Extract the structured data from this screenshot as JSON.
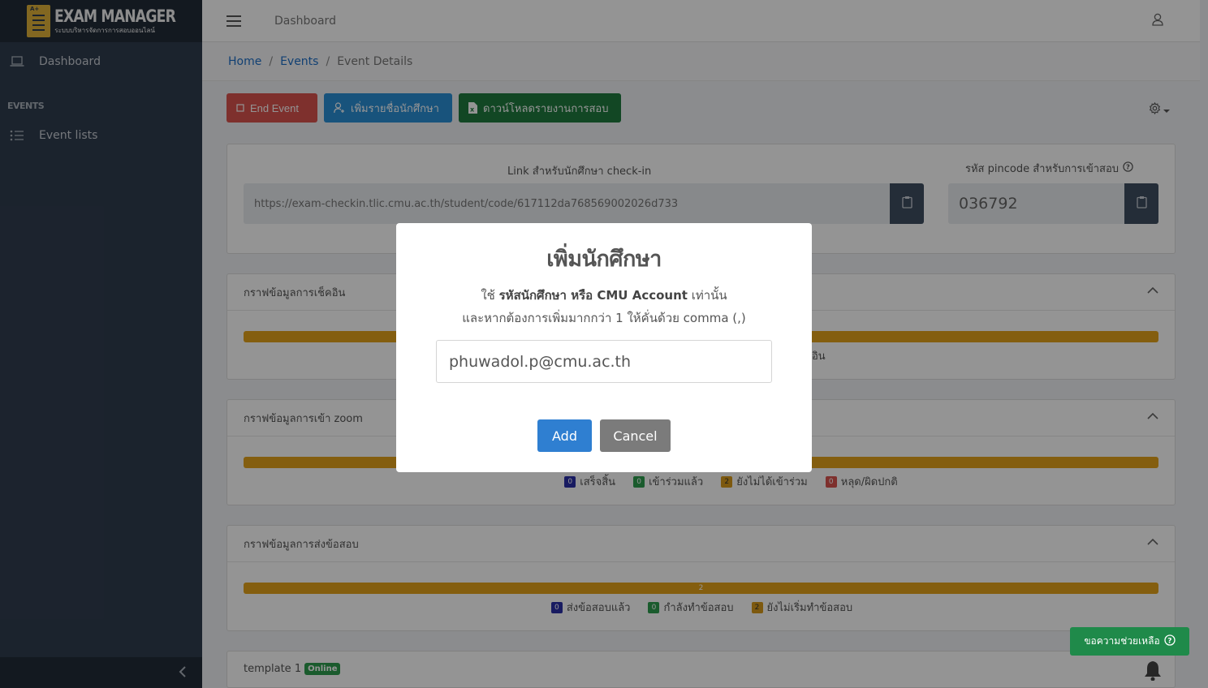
{
  "brand": {
    "title": "EXAM MANAGER",
    "subtitle": "ระบบบริหารจัดการการสอบออนไลน์"
  },
  "sidebar": {
    "items": [
      {
        "label": "Dashboard",
        "icon": "laptop-icon"
      }
    ],
    "section": "EVENTS",
    "section_items": [
      {
        "label": "Event lists",
        "icon": "list-icon"
      }
    ]
  },
  "topbar": {
    "title": "Dashboard"
  },
  "breadcrumb": {
    "home": "Home",
    "events": "Events",
    "current": "Event Details"
  },
  "toolbar": {
    "end_event": "End Event",
    "add_students": "เพิ่มรายชื่อนักศึกษา",
    "download_report": "ดาวน์โหลดรายงานการสอบ"
  },
  "links": {
    "checkin_label": "Link สำหรับนักศึกษา check-in",
    "checkin_url": "https://exam-checkin.tlic.cmu.ac.th/student/code/617112da768569002026d733",
    "pincode_label": "รหัส pincode สำหรับการเข้าสอบ",
    "pincode": "036792"
  },
  "sections": [
    {
      "title": "กราฟข้อมูลการเช็คอิน",
      "bar_label": "",
      "legend_tail": "อิน"
    },
    {
      "title": "กราฟข้อมูลการเข้า zoom",
      "legend": [
        {
          "count": "0",
          "label": "เสร็จสิ้น"
        },
        {
          "count": "0",
          "label": "เข้าร่วมแล้ว"
        },
        {
          "count": "2",
          "label": "ยังไม่ได้เข้าร่วม"
        },
        {
          "count": "0",
          "label": "หลุด/ผิดปกติ"
        }
      ]
    },
    {
      "title": "กราฟข้อมูลการส่งข้อสอบ",
      "bar_label": "2",
      "legend": [
        {
          "count": "0",
          "label": "ส่งข้อสอบแล้ว"
        },
        {
          "count": "0",
          "label": "กำลังทำข้อสอบ"
        },
        {
          "count": "2",
          "label": "ยังไม่เริ่มทำข้อสอบ"
        }
      ]
    }
  ],
  "template": {
    "name": "template 1",
    "status": "Online"
  },
  "help": {
    "label": "ขอความช่วยเหลือ"
  },
  "modal": {
    "title": "เพิ่มนักศึกษา",
    "line1_prefix": "ใช้",
    "line1_bold": "รหัสนักศึกษา หรือ CMU Account",
    "line1_suffix": "เท่านั้น",
    "line2": "และหากต้องการเพิ่มมากกว่า 1 ให้คั่นด้วย comma (,)",
    "input_value": "phuwadol.p@cmu.ac.th",
    "add_label": "Add",
    "cancel_label": "Cancel"
  },
  "colors": {
    "sidebar": "#303d4f",
    "danger": "#d9534f",
    "primary": "#2a8fd6",
    "success": "#1f7a3f",
    "warning": "#e3a21a"
  }
}
